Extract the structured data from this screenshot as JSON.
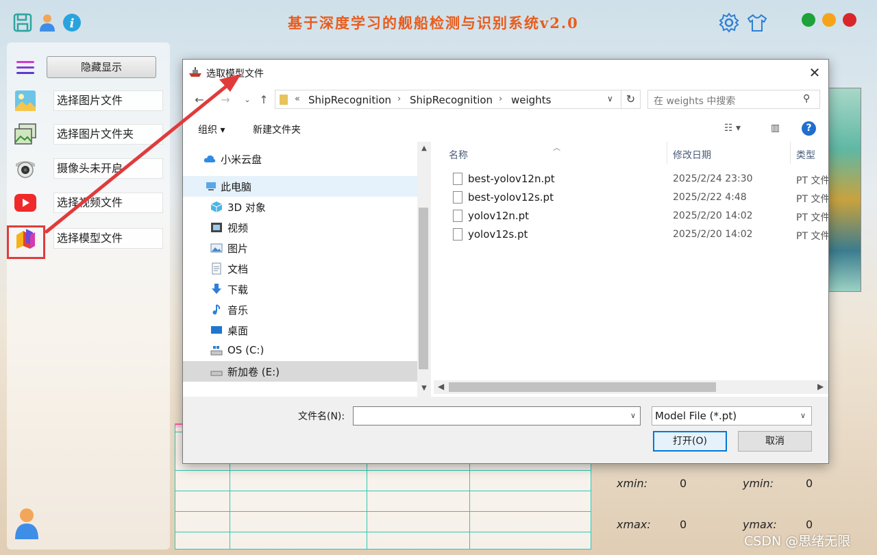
{
  "app": {
    "title": "基于深度学习的舰船检测与识别系统v2.0",
    "colors": {
      "title": "#e85c1c",
      "close": "#d9262b",
      "minimize": "#f5a41a",
      "maximize": "#1fa23a",
      "highlight": "#e03b3b",
      "arrow": "#e03b3b"
    },
    "top_icons": [
      "save-icon",
      "user-icon",
      "info-icon",
      "settings-icon",
      "skin-icon"
    ]
  },
  "sidebar": {
    "toggle_label": "隐藏显示",
    "items": [
      {
        "label": "选择图片文件",
        "icon": "image-icon"
      },
      {
        "label": "选择图片文件夹",
        "icon": "folder-images-icon"
      },
      {
        "label": "摄像头未开启",
        "icon": "camera-icon"
      },
      {
        "label": "选择视频文件",
        "icon": "video-icon"
      },
      {
        "label": "选择模型文件",
        "icon": "model-cube-icon"
      }
    ]
  },
  "results": {
    "xmin_label": "xmin:",
    "xmin_value": "0",
    "ymin_label": "ymin:",
    "ymin_value": "0",
    "xmax_label": "xmax:",
    "xmax_value": "0",
    "ymax_label": "ymax:",
    "ymax_value": "0"
  },
  "watermark": "CSDN @思绪无限",
  "dialog": {
    "title": "选取模型文件",
    "breadcrumb_prefix": "«",
    "breadcrumb": [
      "ShipRecognition",
      "ShipRecognition",
      "weights"
    ],
    "search_placeholder": "在 weights 中搜索",
    "organize_label": "组织 ▾",
    "new_folder_label": "新建文件夹",
    "nav_items": [
      {
        "label": "小米云盘",
        "icon": "cloud-icon"
      },
      {
        "label": "此电脑",
        "icon": "computer-icon"
      },
      {
        "label": "3D 对象",
        "icon": "3d-objects-icon"
      },
      {
        "label": "视频",
        "icon": "videos-icon"
      },
      {
        "label": "图片",
        "icon": "pictures-icon"
      },
      {
        "label": "文档",
        "icon": "documents-icon"
      },
      {
        "label": "下载",
        "icon": "download-icon"
      },
      {
        "label": "音乐",
        "icon": "music-icon"
      },
      {
        "label": "桌面",
        "icon": "desktop-icon"
      },
      {
        "label": "OS (C:)",
        "icon": "drive-c-icon"
      },
      {
        "label": "新加卷 (E:)",
        "icon": "drive-e-icon"
      }
    ],
    "columns": {
      "name": "名称",
      "date": "修改日期",
      "type": "类型"
    },
    "files": [
      {
        "name": "best-yolov12n.pt",
        "date": "2025/2/24 23:30",
        "type": "PT 文件"
      },
      {
        "name": "best-yolov12s.pt",
        "date": "2025/2/22 4:48",
        "type": "PT 文件"
      },
      {
        "name": "yolov12n.pt",
        "date": "2025/2/20 14:02",
        "type": "PT 文件"
      },
      {
        "name": "yolov12s.pt",
        "date": "2025/2/20 14:02",
        "type": "PT 文件"
      }
    ],
    "filename_label": "文件名(N):",
    "filename_value": "",
    "filter_value": "Model File (*.pt)",
    "open_label": "打开(O)",
    "cancel_label": "取消"
  }
}
